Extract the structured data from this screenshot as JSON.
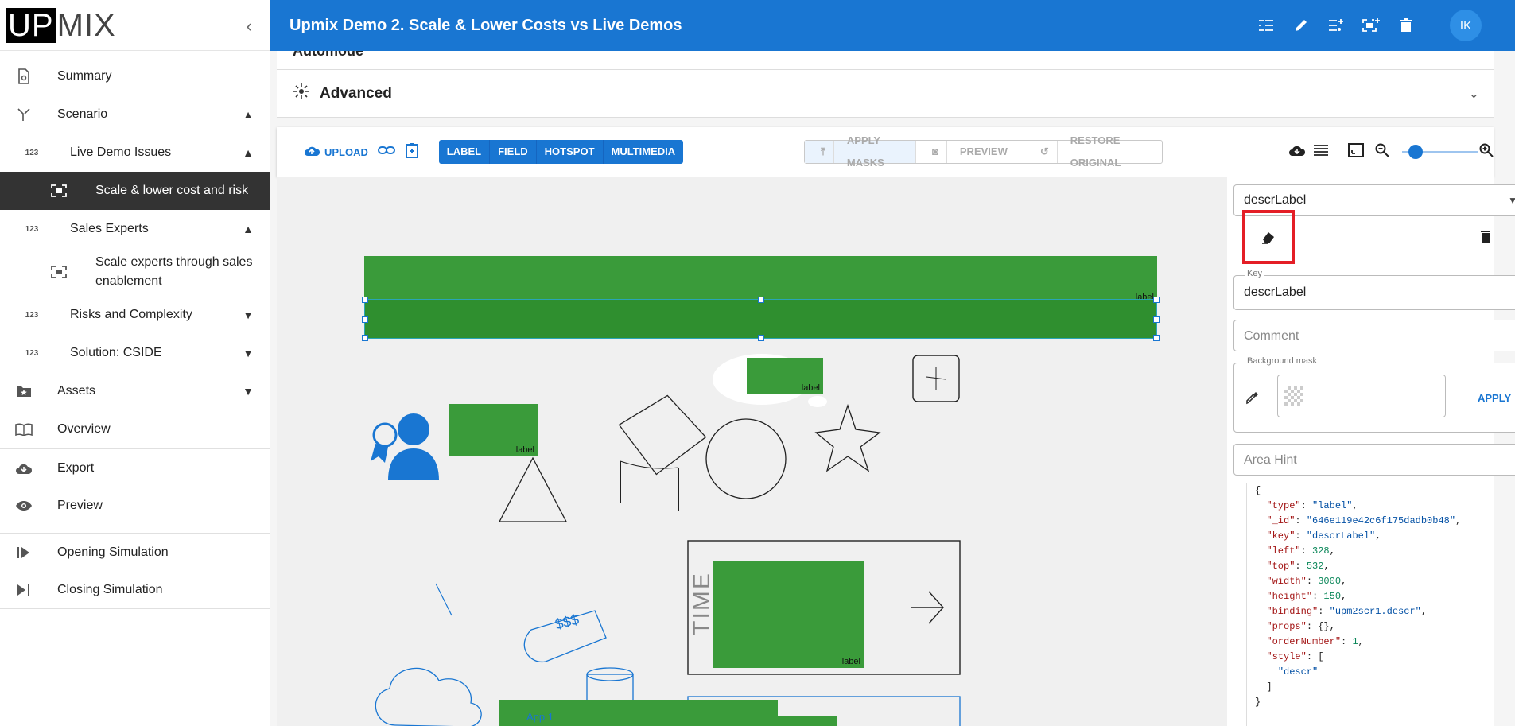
{
  "logo": {
    "part1": "UP",
    "part2": "MIX"
  },
  "sidebar": {
    "collapse_glyph": "‹",
    "items": [
      {
        "label": "Summary",
        "icon": "settings-doc-icon"
      },
      {
        "label": "Scenario",
        "icon": "fork-icon"
      },
      {
        "label": "Live Demo Issues",
        "icon": "numbers-icon"
      },
      {
        "label": "Scale & lower cost and risk",
        "icon": "capture-icon"
      },
      {
        "label": "Sales Experts",
        "icon": "numbers-icon"
      },
      {
        "label": "Scale experts through sales enablement",
        "icon": "capture-icon"
      },
      {
        "label": "Risks and Complexity",
        "icon": "numbers-icon"
      },
      {
        "label": "Solution: CSIDE",
        "icon": "numbers-icon"
      },
      {
        "label": "Assets",
        "icon": "folder-star-icon"
      },
      {
        "label": "Overview",
        "icon": "book-icon"
      },
      {
        "label": "Export",
        "icon": "cloud-download-icon"
      },
      {
        "label": "Preview",
        "icon": "eye-icon"
      },
      {
        "label": "Opening Simulation",
        "icon": "play-bar-icon"
      },
      {
        "label": "Closing Simulation",
        "icon": "skip-next-icon"
      }
    ]
  },
  "header": {
    "title": "Upmix Demo 2. Scale & Lower Costs vs Live Demos",
    "avatar": "IK"
  },
  "panels": {
    "collapsed_label": "Automode",
    "advanced_label": "Advanced"
  },
  "toolbar": {
    "upload": "UPLOAD",
    "types": [
      "LABEL",
      "FIELD",
      "HOTSPOT",
      "MULTIMEDIA"
    ],
    "apply_masks": "APPLY MASKS",
    "preview": "PREVIEW",
    "restore": "RESTORE ORIGINAL",
    "zoom_level": 0.1
  },
  "canvas": {
    "label_text": "label",
    "time_text": "TIME",
    "price_tag": "$$$",
    "app_text": "App 1"
  },
  "right_panel": {
    "selected": "descrLabel",
    "key_label": "Key",
    "key_value": "descrLabel",
    "comment_placeholder": "Comment",
    "bg_mask_label": "Background mask",
    "apply": "APPLY",
    "area_hint_placeholder": "Area Hint"
  },
  "json_view": {
    "type": "label",
    "_id": "646e119e42c6f175dadb0b48",
    "key": "descrLabel",
    "left": "328",
    "top": "532",
    "width": "3000",
    "height": "150",
    "binding": "upm2scr1.descr",
    "props": "{}",
    "orderNumber": "1",
    "style": "descr"
  },
  "colors": {
    "brand_blue": "#1976d2",
    "mask_green": "#3a9b3a",
    "highlight_red": "#e41e26"
  }
}
